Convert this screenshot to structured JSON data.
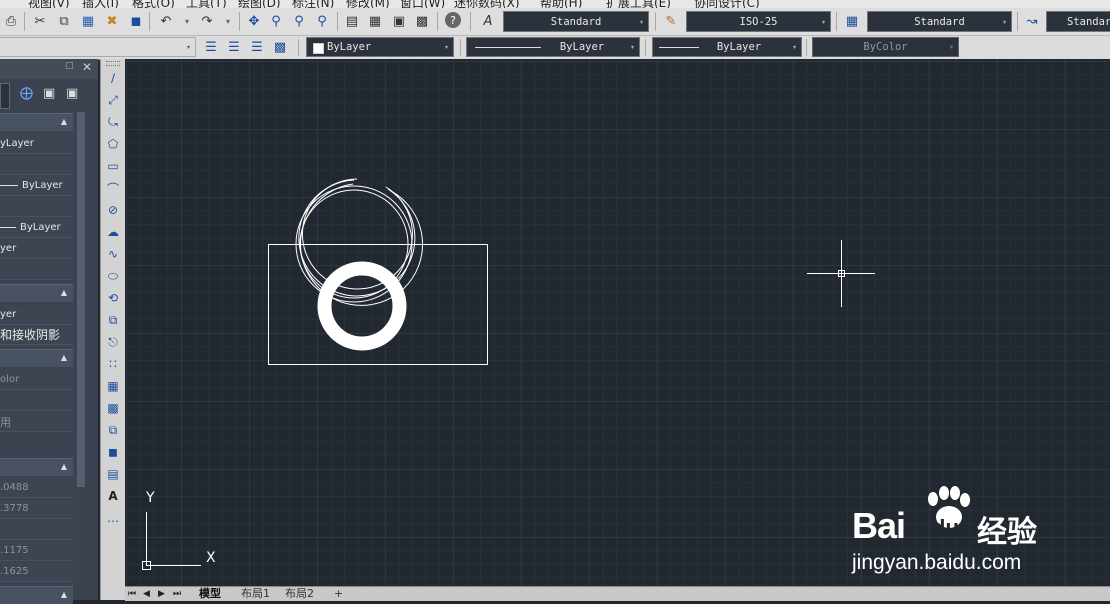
{
  "menu": [
    "视图(V)",
    "插入(I)",
    "格式(O)",
    "工具(T)",
    "绘图(D)",
    "标注(N)",
    "修改(M)",
    "窗口(W)",
    "迷你数码(X)",
    "帮助(H)",
    "扩展工具(E)",
    "协同设计(C)"
  ],
  "toolbar": {
    "text_style": "Standard",
    "dim_style": "ISO-25",
    "table_style": "Standard",
    "multileader_style": "Standar"
  },
  "properties_bar": {
    "color": "ByLayer",
    "linetype": "ByLayer",
    "lineweight": "ByLayer",
    "plot_style": "ByColor"
  },
  "palette": {
    "rows": [
      "yLayer",
      "",
      "ByLayer",
      "",
      "ByLayer",
      "yer",
      "",
      "yer",
      "和接收阴影",
      "olor",
      "",
      "用",
      ".0488",
      ".3778",
      "",
      ".1175",
      ".1625"
    ]
  },
  "drawing": {
    "ucs_x_label": "X",
    "ucs_y_label": "Y"
  },
  "tabs": {
    "model": "模型",
    "layout1": "布局1",
    "layout2": "布局2",
    "add": "+"
  },
  "watermark": {
    "brand": "Bai",
    "brand2": "du",
    "cn": "经验",
    "url": "jingyan.baidu.com"
  },
  "colors": {
    "canvas": "#212830",
    "grid_major": "#2e3743",
    "palette_bg": "#3b4350",
    "accent_blue": "#2a5fb0"
  }
}
